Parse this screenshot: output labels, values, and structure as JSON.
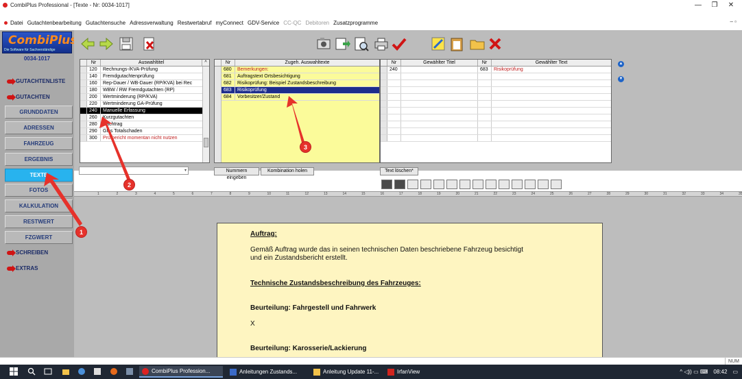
{
  "window": {
    "title": "CombiPlus Professional - [Texte - Nr: 0034-1017]",
    "minimize": "—",
    "restore": "❐",
    "close": "✕"
  },
  "menu": {
    "items": [
      "Datei",
      "Gutachtenbearbeitung",
      "Gutachtensuche",
      "Adressverwaltung",
      "Restwertabruf",
      "myConnect",
      "GDV-Service",
      "CC-QC",
      "Debitoren",
      "Zusatzprogramme"
    ],
    "disabled": [
      "CC-QC",
      "Debitoren"
    ],
    "right_controls": "–  ▫"
  },
  "sidebar": {
    "logo": "CombiPlus",
    "logo_sub": "Die Software für Sachverständige",
    "case_number": "0034-1017",
    "items": [
      {
        "label": "GUTACHTENLISTE",
        "arrow": true
      },
      {
        "label": "GUTACHTEN",
        "arrow": true
      },
      {
        "label": "GRUNDDATEN",
        "arrow": false
      },
      {
        "label": "ADRESSEN",
        "arrow": false
      },
      {
        "label": "FAHRZEUG",
        "arrow": false
      },
      {
        "label": "ERGEBNIS",
        "arrow": false
      },
      {
        "label": "TEXTE",
        "arrow": false,
        "active": true
      },
      {
        "label": "FOTOS",
        "arrow": false
      },
      {
        "label": "KALKULATION",
        "arrow": false
      },
      {
        "label": "RESTWERT",
        "arrow": false
      },
      {
        "label": "FZGWERT",
        "arrow": false
      },
      {
        "label": "SCHREIBEN",
        "arrow": true
      },
      {
        "label": "EXTRAS",
        "arrow": true
      }
    ]
  },
  "toolbar": {
    "icons": [
      "back-arrow-icon",
      "forward-arrow-icon",
      "save-icon",
      "delete-document-icon",
      "camera-icon",
      "transfer-icon",
      "preview-icon",
      "print-icon",
      "checkmark-icon",
      "notes-icon",
      "clipboard-icon",
      "folder-icon",
      "close-x-icon"
    ]
  },
  "list1": {
    "headers": [
      "Nr",
      "Auswahltitel"
    ],
    "rows": [
      {
        "nr": "120",
        "text": "Rechnungs-/KVA-Prüfung"
      },
      {
        "nr": "140",
        "text": "Fremdgutachtenprüfung"
      },
      {
        "nr": "160",
        "text": "Rep-Dauer / WB-Dauer (RP/KVA) bei Rec"
      },
      {
        "nr": "180",
        "text": "WBW / RW Fremdgutachten (RP)"
      },
      {
        "nr": "200",
        "text": "Wertminderung (RP/KVA)"
      },
      {
        "nr": "220",
        "text": "Wertminderung GA-Prüfung"
      },
      {
        "nr": "240",
        "text": "Manuelle Erfassung",
        "selected": true
      },
      {
        "nr": "260",
        "text": "Kurzgutachten"
      },
      {
        "nr": "280",
        "text": "Nachtrag"
      },
      {
        "nr": "290",
        "text": "Glas Totalschaden"
      },
      {
        "nr": "300",
        "text": "Prüfbericht momentan nicht nutzen",
        "red": true
      }
    ]
  },
  "list2": {
    "headers": [
      "Nr",
      "Zugeh. Auswahltexte"
    ],
    "rows": [
      {
        "nr": "680",
        "text": "Bemerkungen:",
        "red": true
      },
      {
        "nr": "681",
        "text": "Auftragstext Ortsbesichtigung"
      },
      {
        "nr": "682",
        "text": "Risikoprüfung: Beispiel Zustandsbeschreibung"
      },
      {
        "nr": "683",
        "text": "Risikoprüfung",
        "highlight": true
      },
      {
        "nr": "684",
        "text": "Vorbesitzer/Zustand"
      }
    ]
  },
  "list3": {
    "headers": [
      "Nr",
      "Gewählter Titel",
      "Nr",
      "Gewählter Text"
    ],
    "rows": [
      {
        "nr1": "240",
        "title": "",
        "nr2": "683",
        "text": "Risikoprüfung"
      }
    ]
  },
  "controls": {
    "combo_arrow": "▾",
    "btn_numbers": "Nummern eingeben",
    "btn_combination": "Kombination holen",
    "btn_delete_text": "Text löschen*",
    "up_arrow": "▲",
    "down_arrow": "▼"
  },
  "ruler": {
    "marks": [
      "1",
      "2",
      "3",
      "4",
      "5",
      "6",
      "7",
      "8",
      "9",
      "10",
      "11",
      "12",
      "13",
      "14",
      "15",
      "16",
      "17",
      "18",
      "19",
      "20",
      "21",
      "22",
      "23",
      "24",
      "25",
      "26",
      "27",
      "28",
      "29",
      "30",
      "31",
      "32",
      "33",
      "34",
      "35"
    ]
  },
  "document": {
    "heading1": "Auftrag:",
    "para1_line1": "Gemäß Auftrag wurde das in seinen technischen Daten beschriebene Fahrzeug besichtigt",
    "para1_line2": "und ein Zustandsbericht erstellt.",
    "heading2": "Technische Zustandsbeschreibung des Fahrzeuges:",
    "heading3": "Beurteilung: Fahrgestell und Fahrwerk",
    "value3": "X",
    "heading4": "Beurteilung: Karosserie/Lackierung"
  },
  "status": {
    "num": "NUM"
  },
  "taskbar": {
    "tasks": [
      {
        "label": "CombiPlus Profession...",
        "active": true
      },
      {
        "label": "Anleitungen Zustands...",
        "active": false
      },
      {
        "label": "Anleitung Update 11-...",
        "active": false
      },
      {
        "label": "IrfanView",
        "active": false
      }
    ],
    "tray_icons": "^ ◁)) ▭ ⌨",
    "clock": "08:42"
  },
  "annotations": [
    "1",
    "2",
    "3"
  ],
  "colors": {
    "accent_active": "#28b3ee",
    "annotation_red": "#e6322b",
    "list_yellow": "#fbfb9a",
    "doc_yellow": "#fef5c1",
    "selected_blue": "#1d2d8c"
  }
}
